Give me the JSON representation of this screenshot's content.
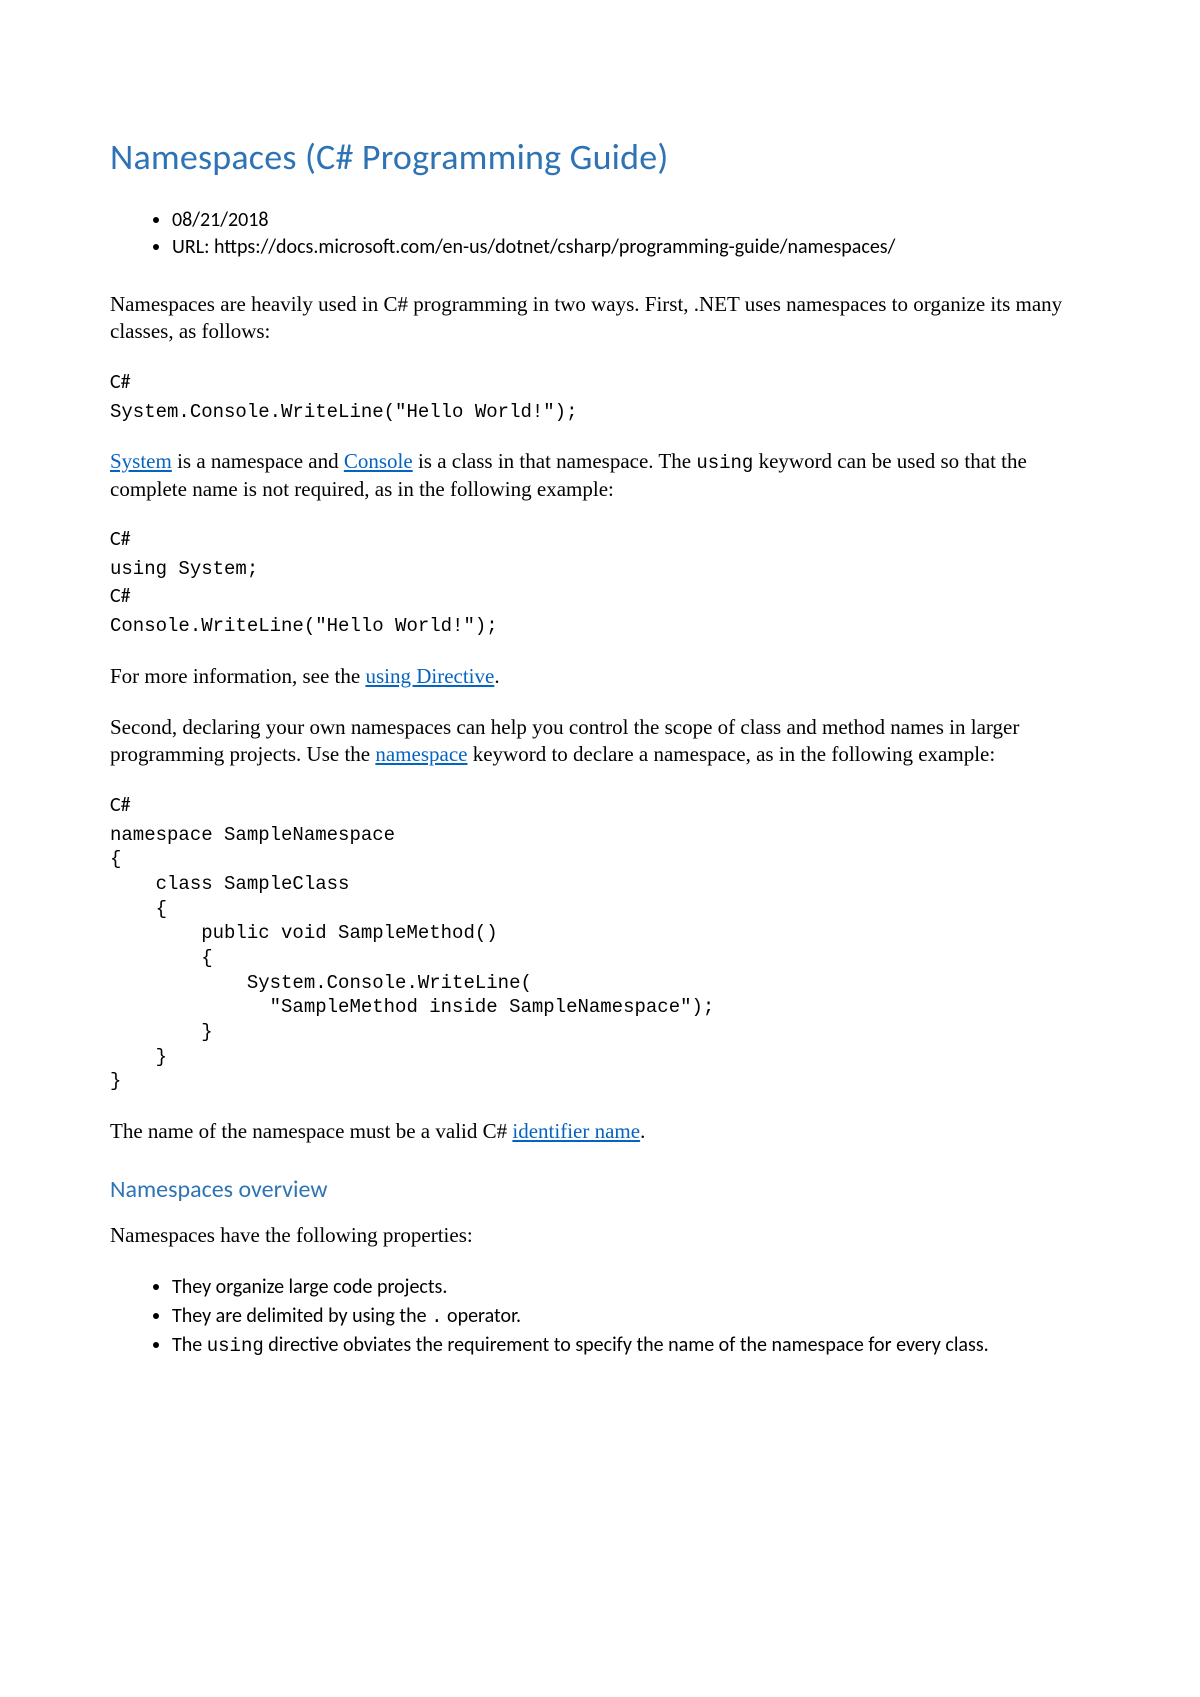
{
  "title": "Namespaces (C# Programming Guide)",
  "meta": {
    "date": "08/21/2018",
    "url_label": "URL: https://docs.microsoft.com/en-us/dotnet/csharp/programming-guide/namespaces/"
  },
  "intro": "Namespaces are heavily used in C# programming in two ways. First, .NET uses namespaces to organize its many classes, as follows:",
  "lang": "C#",
  "code1": "System.Console.WriteLine(\"Hello World!\");",
  "para2": {
    "link1": "System",
    "mid1": " is a namespace and ",
    "link2": "Console",
    "mid2": " is a class in that namespace. The ",
    "kw": "using",
    "tail": " keyword can be used so that the complete name is not required, as in the following example:"
  },
  "code2a": "using System;",
  "code2b": "Console.WriteLine(\"Hello World!\");",
  "para3": {
    "lead": "For more information, see the ",
    "link": "using Directive",
    "tail": "."
  },
  "para4": {
    "lead": "Second, declaring your own namespaces can help you control the scope of class and method names in larger programming projects. Use the ",
    "link": "namespace",
    "tail": " keyword to declare a namespace, as in the following example:"
  },
  "code3": "namespace SampleNamespace\n{\n    class SampleClass\n    {\n        public void SampleMethod()\n        {\n            System.Console.WriteLine(\n              \"SampleMethod inside SampleNamespace\");\n        }\n    }\n}",
  "para5": {
    "lead": "The name of the namespace must be a valid C# ",
    "link": "identifier name",
    "tail": "."
  },
  "section2": "Namespaces overview",
  "props_intro": "Namespaces have the following properties:",
  "props": {
    "p1": "They organize large code projects.",
    "p2_lead": "They are delimited by using the ",
    "p2_op": ".",
    "p2_tail": " operator.",
    "p3_lead": "The ",
    "p3_kw": "using",
    "p3_tail": " directive obviates the requirement to specify the name of the namespace for every class."
  }
}
